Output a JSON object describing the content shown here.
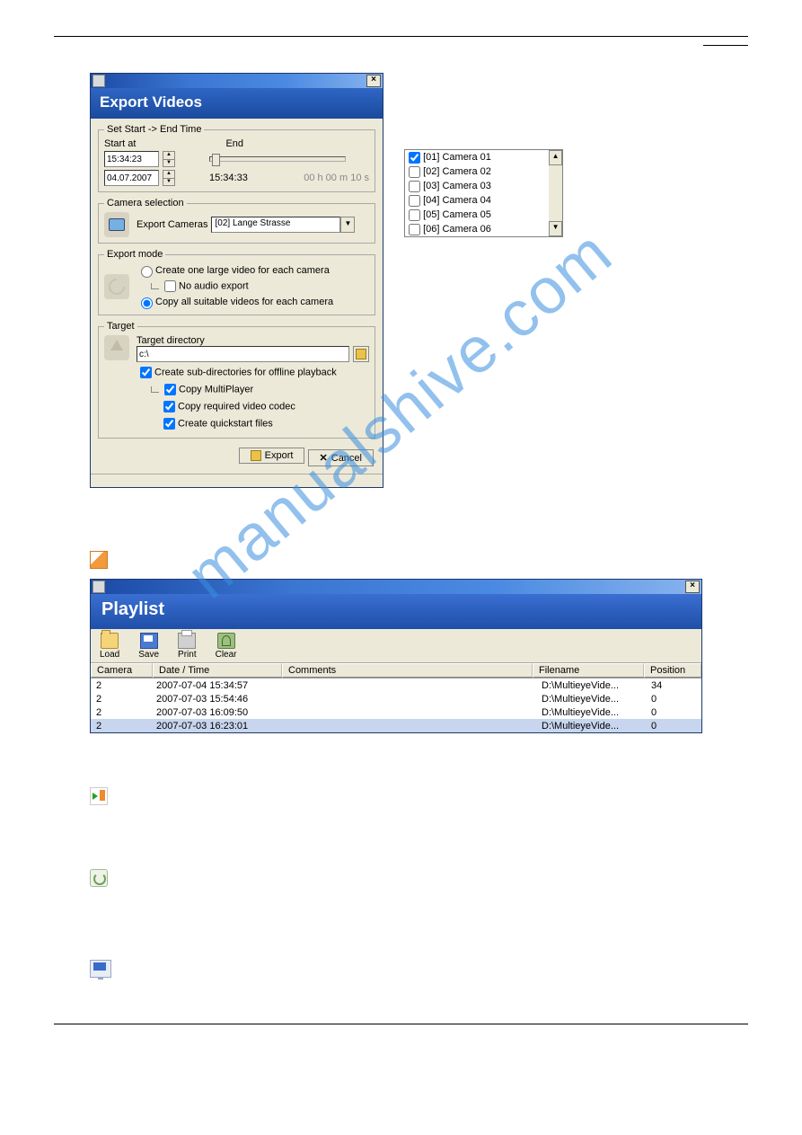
{
  "page": {
    "watermark": "manualshive.com"
  },
  "exportDialog": {
    "title": "Export Videos",
    "time": {
      "legend": "Set Start -> End Time",
      "startLabel": "Start at",
      "endLabel": "End",
      "startTime": "15:34:23",
      "startDate": "04.07.2007",
      "endTime": "15:34:33",
      "duration": "00 h 00 m 10 s"
    },
    "camera": {
      "legend": "Camera selection",
      "label": "Export Cameras",
      "value": "[02] Lange Strasse"
    },
    "mode": {
      "legend": "Export mode",
      "opt1": "Create one large video for each camera",
      "noAudio": "No audio export",
      "opt2": "Copy all suitable videos for each camera"
    },
    "target": {
      "legend": "Target",
      "dirLabel": "Target directory",
      "dirValue": "c:\\",
      "chk1": "Create sub-directories for offline playback",
      "chk2": "Copy MultiPlayer",
      "chk3": "Copy required video codec",
      "chk4": "Create quickstart files"
    },
    "buttons": {
      "export": "Export",
      "cancel": "Cancel"
    }
  },
  "cameraList": [
    {
      "label": "[01] Camera 01",
      "checked": true
    },
    {
      "label": "[02] Camera 02",
      "checked": false
    },
    {
      "label": "[03] Camera 03",
      "checked": false
    },
    {
      "label": "[04] Camera 04",
      "checked": false
    },
    {
      "label": "[05] Camera 05",
      "checked": false
    },
    {
      "label": "[06] Camera 06",
      "checked": false
    }
  ],
  "playlist": {
    "title": "Playlist",
    "toolbar": {
      "load": "Load",
      "save": "Save",
      "print": "Print",
      "clear": "Clear"
    },
    "headers": {
      "camera": "Camera",
      "datetime": "Date / Time",
      "comments": "Comments",
      "filename": "Filename",
      "position": "Position"
    },
    "rows": [
      {
        "camera": "2",
        "datetime": "2007-07-04 15:34:57",
        "comments": "",
        "filename": "D:\\MultieyeVide...",
        "position": "34"
      },
      {
        "camera": "2",
        "datetime": "2007-07-03 15:54:46",
        "comments": "",
        "filename": "D:\\MultieyeVide...",
        "position": "0"
      },
      {
        "camera": "2",
        "datetime": "2007-07-03 16:09:50",
        "comments": "",
        "filename": "D:\\MultieyeVide...",
        "position": "0"
      },
      {
        "camera": "2",
        "datetime": "2007-07-03 16:23:01",
        "comments": "",
        "filename": "D:\\MultieyeVide...",
        "position": "0"
      }
    ]
  }
}
